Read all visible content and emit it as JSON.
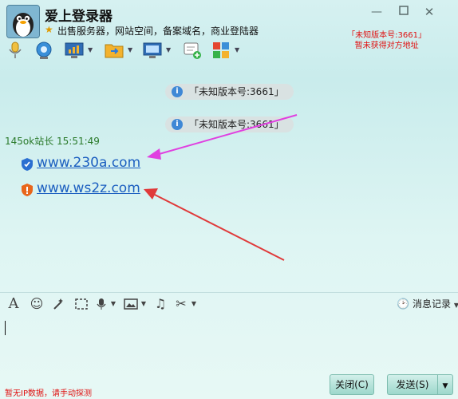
{
  "window": {
    "title": "爱上登录器",
    "signature": "出售服务器，网站空间，备案域名，商业登陆器",
    "version_status_line1": "「未知版本号:3661」",
    "version_status_line2": "暂未获得对方地址",
    "controls": [
      "minimize",
      "maximize",
      "close"
    ]
  },
  "toolbar": {
    "items": [
      "microphone-icon",
      "camera-icon",
      "screen-share-icon",
      "file-transfer-icon",
      "remote-desktop-icon",
      "add-app-icon",
      "apps-grid-icon"
    ]
  },
  "chat": {
    "system_messages": [
      "「未知版本号:3661」",
      "「未知版本号:3661」"
    ],
    "sender": "145ok站长  15:51:49",
    "links": [
      {
        "text": "www.230a.com",
        "shield": "safe",
        "shield_color": "#2a6fd1"
      },
      {
        "text": "www.ws2z.com",
        "shield": "warning",
        "shield_color": "#e8661b"
      }
    ],
    "annotation_arrow_colors": [
      "#e040e0",
      "#e03a3a"
    ]
  },
  "input_toolbar": {
    "items": [
      "font-icon",
      "emoji-icon",
      "magic-icon",
      "screenshot-icon",
      "voice-icon",
      "image-icon",
      "music-icon",
      "scissors-icon"
    ],
    "history_label": "消息记录"
  },
  "footer": {
    "ip_status": "暂无IP数据，请手动探测",
    "close_label": "关闭(C)",
    "send_label": "发送(S)"
  },
  "colors": {
    "background": "#d6f1f1",
    "link": "#1c5fc0",
    "sender": "#2a7a2a",
    "alert": "#e01010"
  }
}
